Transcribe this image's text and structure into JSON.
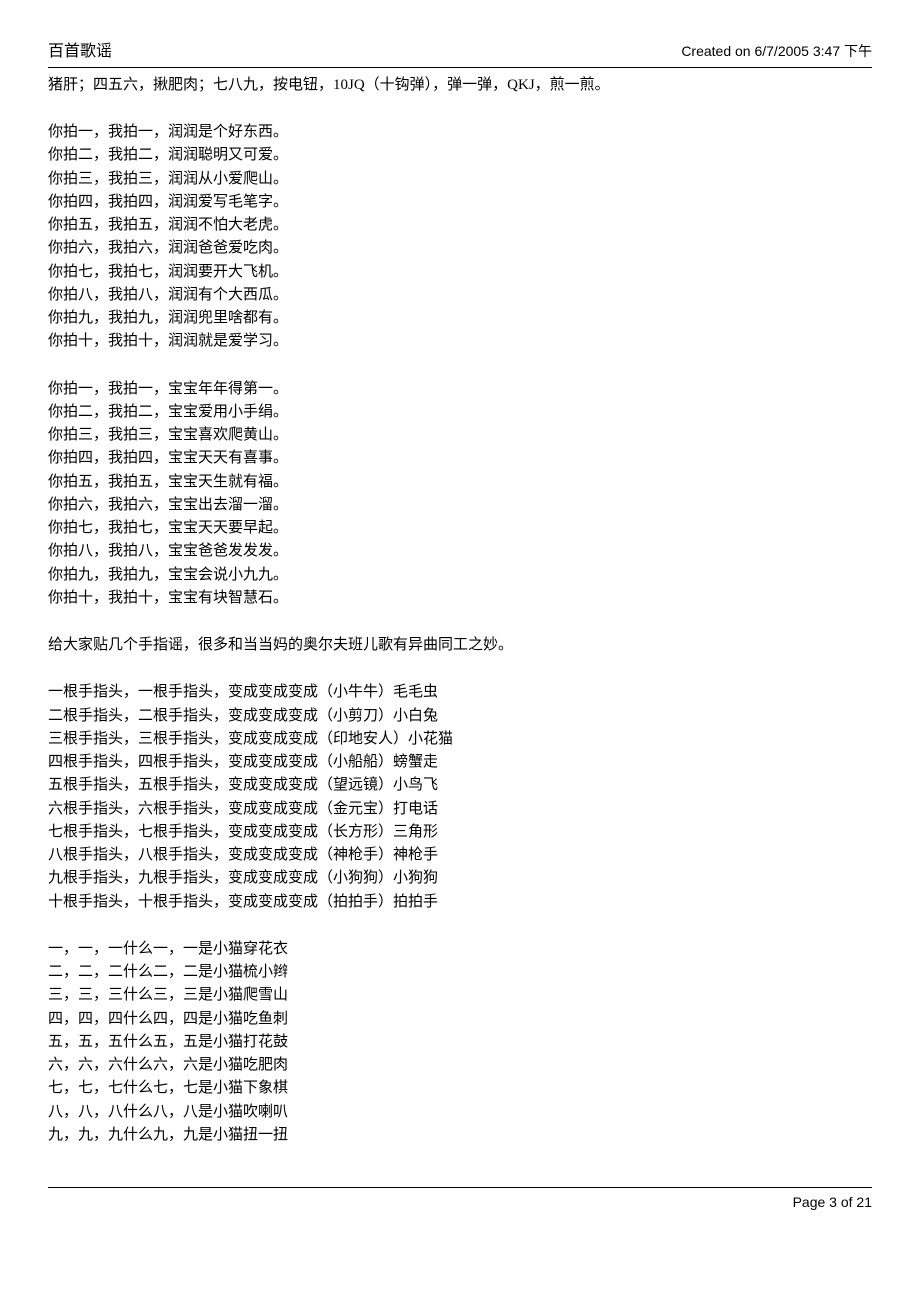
{
  "header": {
    "title": "百首歌谣",
    "created": "Created on 6/7/2005 3:47 下午"
  },
  "topline": "猪肝；四五六，揪肥肉；七八九，按电钮，10JQ（十钩弹），弹一弹，QKJ，煎一煎。",
  "block1": [
    "你拍一，我拍一，润润是个好东西。",
    "你拍二，我拍二，润润聪明又可爱。",
    "你拍三，我拍三，润润从小爱爬山。",
    "你拍四，我拍四，润润爱写毛笔字。",
    "你拍五，我拍五，润润不怕大老虎。",
    "你拍六，我拍六，润润爸爸爱吃肉。",
    "你拍七，我拍七，润润要开大飞机。",
    "你拍八，我拍八，润润有个大西瓜。",
    "你拍九，我拍九，润润兜里啥都有。",
    "你拍十，我拍十，润润就是爱学习。"
  ],
  "block2": [
    "你拍一，我拍一，宝宝年年得第一。",
    "你拍二，我拍二，宝宝爱用小手绢。",
    "你拍三，我拍三，宝宝喜欢爬黄山。",
    "你拍四，我拍四，宝宝天天有喜事。",
    "你拍五，我拍五，宝宝天生就有福。",
    "你拍六，我拍六，宝宝出去溜一溜。",
    "你拍七，我拍七，宝宝天天要早起。",
    "你拍八，我拍八，宝宝爸爸发发发。",
    "你拍九，我拍九，宝宝会说小九九。",
    "你拍十，我拍十，宝宝有块智慧石。"
  ],
  "intro3": "给大家贴几个手指谣，很多和当当妈的奥尔夫班儿歌有异曲同工之妙。",
  "block3": [
    "一根手指头，一根手指头，变成变成变成（小牛牛）毛毛虫",
    "二根手指头，二根手指头，变成变成变成（小剪刀）小白兔",
    "三根手指头，三根手指头，变成变成变成（印地安人）小花猫",
    "四根手指头，四根手指头，变成变成变成（小船船）螃蟹走",
    "五根手指头，五根手指头，变成变成变成（望远镜）小鸟飞",
    "六根手指头，六根手指头，变成变成变成（金元宝）打电话",
    "七根手指头，七根手指头，变成变成变成（长方形）三角形",
    "八根手指头，八根手指头，变成变成变成（神枪手）神枪手",
    "九根手指头，九根手指头，变成变成变成（小狗狗）小狗狗",
    "十根手指头，十根手指头，变成变成变成（拍拍手）拍拍手"
  ],
  "block4": [
    "一，一，一什么一，一是小猫穿花衣",
    "二，二，二什么二，二是小猫梳小辫",
    "三，三，三什么三，三是小猫爬雪山",
    "四，四，四什么四，四是小猫吃鱼刺",
    "五，五，五什么五，五是小猫打花鼓",
    "六，六，六什么六，六是小猫吃肥肉",
    "七，七，七什么七，七是小猫下象棋",
    "八，八，八什么八，八是小猫吹喇叭",
    "九，九，九什么九，九是小猫扭一扭"
  ],
  "footer": {
    "page": "Page 3 of 21"
  }
}
